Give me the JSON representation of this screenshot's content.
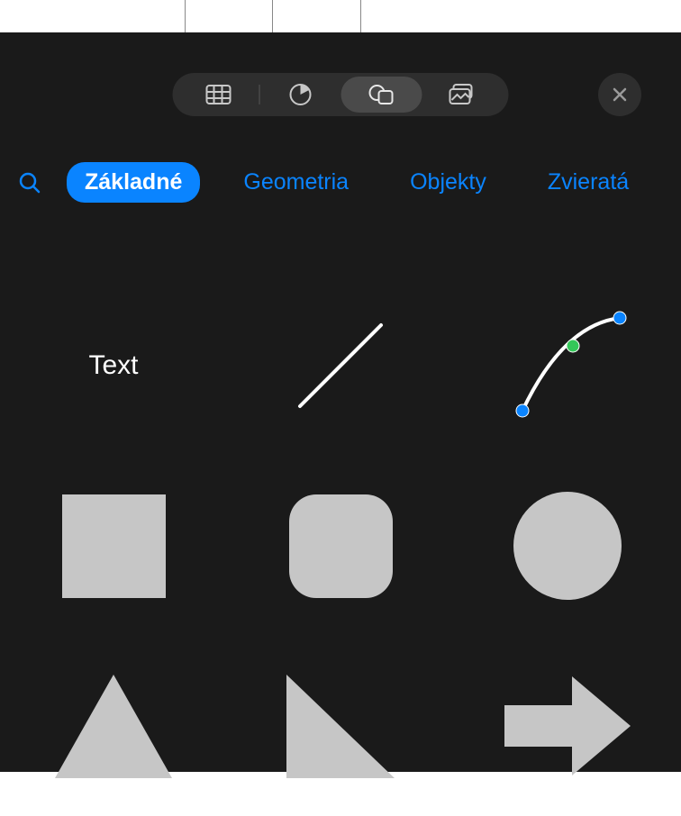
{
  "toolbar": {
    "items": [
      {
        "name": "table-icon"
      },
      {
        "name": "chart-icon"
      },
      {
        "name": "shapes-icon",
        "active": true
      },
      {
        "name": "media-icon"
      }
    ],
    "close": "close-icon"
  },
  "categories": {
    "search_icon": "search-icon",
    "items": [
      {
        "label": "Základné",
        "active": true
      },
      {
        "label": "Geometria",
        "active": false
      },
      {
        "label": "Objekty",
        "active": false
      },
      {
        "label": "Zvieratá",
        "active": false
      }
    ]
  },
  "shapes": {
    "text_label": "Text",
    "colors": {
      "shape_fill": "#c6c6c6",
      "accent_blue": "#0a84ff",
      "curve_green": "#34c759"
    }
  }
}
